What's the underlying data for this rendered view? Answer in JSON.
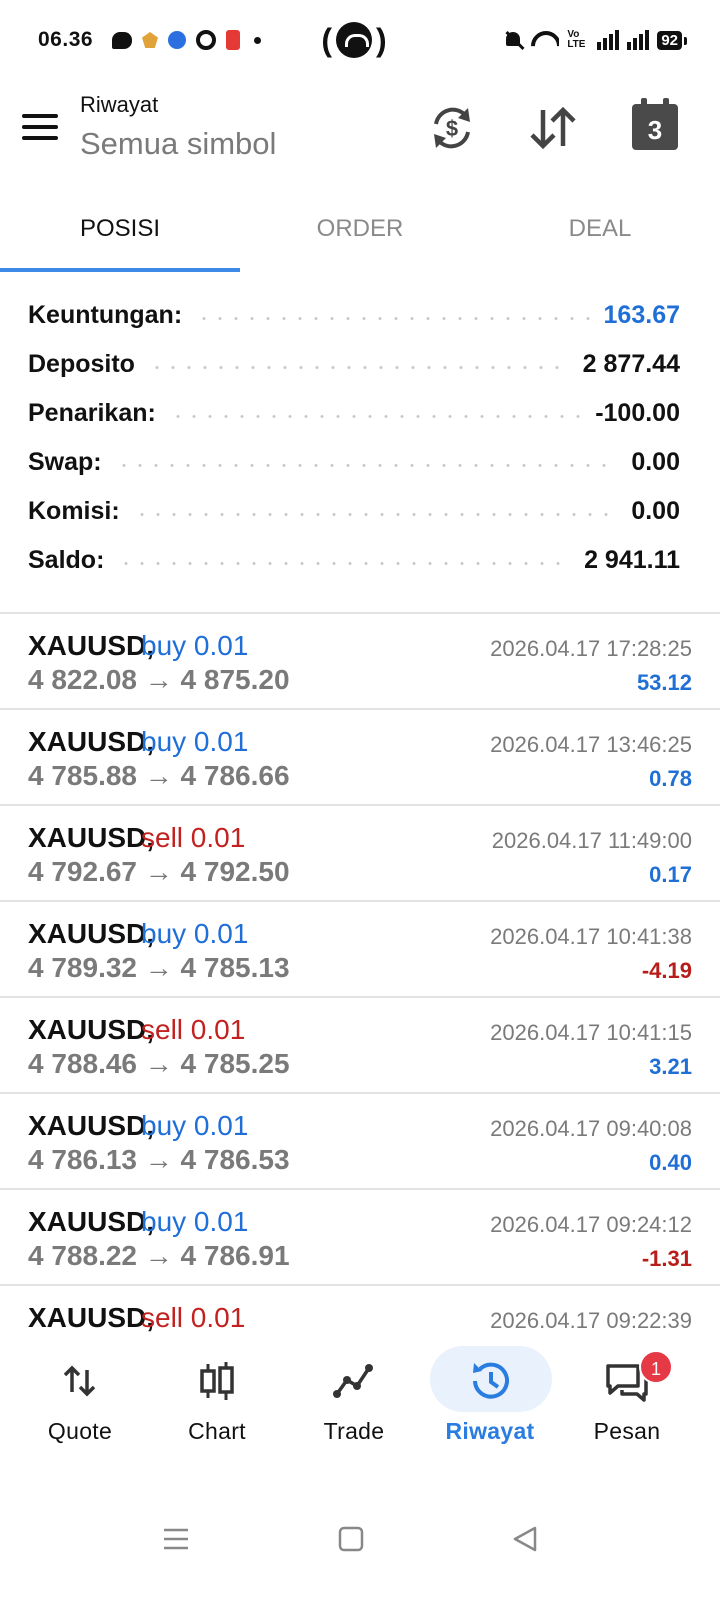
{
  "status_bar": {
    "time": "06.36",
    "battery": "92",
    "volte": "Vo LTE"
  },
  "header": {
    "title": "Riwayat",
    "subtitle": "Semua simbol",
    "calendar_day": "3"
  },
  "tabs": [
    {
      "label": "POSISI",
      "active": true
    },
    {
      "label": "ORDER",
      "active": false
    },
    {
      "label": "DEAL",
      "active": false
    }
  ],
  "summary": [
    {
      "label": "Keuntungan:",
      "value": "163.67",
      "highlight": true
    },
    {
      "label": "Deposito",
      "value": "2 877.44",
      "highlight": false
    },
    {
      "label": "Penarikan:",
      "value": "-100.00",
      "highlight": false
    },
    {
      "label": "Swap:",
      "value": "0.00",
      "highlight": false
    },
    {
      "label": "Komisi:",
      "value": "0.00",
      "highlight": false
    },
    {
      "label": "Saldo:",
      "value": "2 941.11",
      "highlight": false
    }
  ],
  "history": [
    {
      "symbol": "XAUUSD,",
      "side": "buy 0.01",
      "type": "buy",
      "prices": "4 822.08 → 4 875.20",
      "time": "2026.04.17 17:28:25",
      "profit": "53.12"
    },
    {
      "symbol": "XAUUSD,",
      "side": "buy 0.01",
      "type": "buy",
      "prices": "4 785.88 → 4 786.66",
      "time": "2026.04.17 13:46:25",
      "profit": "0.78"
    },
    {
      "symbol": "XAUUSD,",
      "side": "sell 0.01",
      "type": "sell",
      "prices": "4 792.67 → 4 792.50",
      "time": "2026.04.17 11:49:00",
      "profit": "0.17"
    },
    {
      "symbol": "XAUUSD,",
      "side": "buy 0.01",
      "type": "buy",
      "prices": "4 789.32 → 4 785.13",
      "time": "2026.04.17 10:41:38",
      "profit": "-4.19"
    },
    {
      "symbol": "XAUUSD,",
      "side": "sell 0.01",
      "type": "sell",
      "prices": "4 788.46 → 4 785.25",
      "time": "2026.04.17 10:41:15",
      "profit": "3.21"
    },
    {
      "symbol": "XAUUSD,",
      "side": "buy 0.01",
      "type": "buy",
      "prices": "4 786.13 → 4 786.53",
      "time": "2026.04.17 09:40:08",
      "profit": "0.40"
    },
    {
      "symbol": "XAUUSD,",
      "side": "buy 0.01",
      "type": "buy",
      "prices": "4 788.22 → 4 786.91",
      "time": "2026.04.17 09:24:12",
      "profit": "-1.31"
    },
    {
      "symbol": "XAUUSD,",
      "side": "sell 0.01",
      "type": "sell",
      "prices": "",
      "time": "2026.04.17 09:22:39",
      "profit": ""
    }
  ],
  "bottom_nav": [
    {
      "label": "Quote",
      "icon": "quote-arrows-icon",
      "active": false
    },
    {
      "label": "Chart",
      "icon": "candlestick-chart-icon",
      "active": false
    },
    {
      "label": "Trade",
      "icon": "trade-line-icon",
      "active": false
    },
    {
      "label": "Riwayat",
      "icon": "history-clock-icon",
      "active": true
    },
    {
      "label": "Pesan",
      "icon": "messages-icon",
      "active": false,
      "badge": "1"
    }
  ],
  "colors": {
    "accent": "#2a7de0",
    "profit_positive": "#1f6fd6",
    "profit_negative": "#b81d1a",
    "sell": "#c2221f",
    "muted_text": "#7a7a7a"
  }
}
